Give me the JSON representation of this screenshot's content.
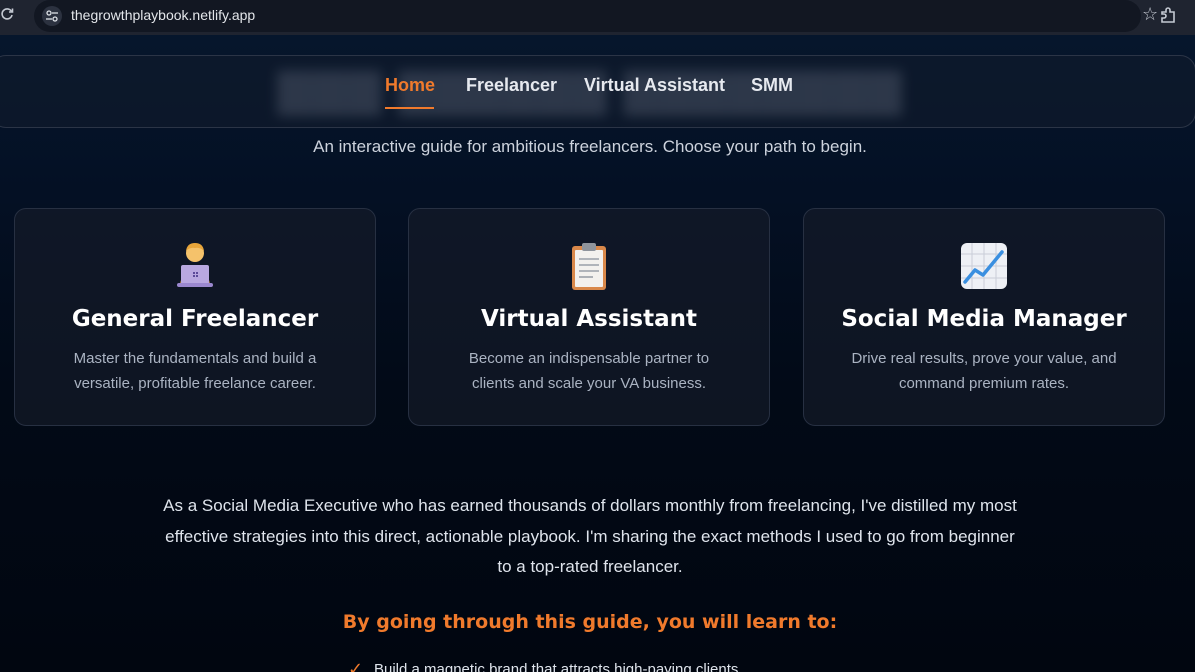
{
  "browser": {
    "url": "thegrowthplaybook.netlify.app",
    "reload_icon": "reload-icon",
    "site_info_icon": "tune-icon",
    "bookmark_icon": "star-icon",
    "extensions_icon": "puzzle-icon"
  },
  "nav": {
    "items": [
      {
        "label": "Home",
        "active": true
      },
      {
        "label": "Freelancer",
        "active": false
      },
      {
        "label": "Virtual Assistant",
        "active": false
      },
      {
        "label": "SMM",
        "active": false
      }
    ],
    "accent": "#f07a2c"
  },
  "hero": {
    "subtitle": "An interactive guide for ambitious freelancers. Choose your path to begin."
  },
  "cards": [
    {
      "icon": "person-laptop-icon",
      "title": "General Freelancer",
      "description": "Master the fundamentals and build a versatile, profitable freelance career."
    },
    {
      "icon": "clipboard-icon",
      "title": "Virtual Assistant",
      "description": "Become an indispensable partner to clients and scale your VA business."
    },
    {
      "icon": "chart-increasing-icon",
      "title": "Social Media Manager",
      "description": "Drive real results, prove your value, and command premium rates."
    }
  ],
  "intro": {
    "text": "As a Social Media Executive who has earned thousands of dollars monthly from freelancing, I've distilled my most effective strategies into this direct, actionable playbook. I'm sharing the exact methods I used to go from beginner to a top-rated freelancer."
  },
  "learn": {
    "heading": "By going through this guide, you will learn to:",
    "items": [
      {
        "icon": "check-icon",
        "text": "Build a magnetic brand that attracts high-paying clients."
      }
    ]
  }
}
